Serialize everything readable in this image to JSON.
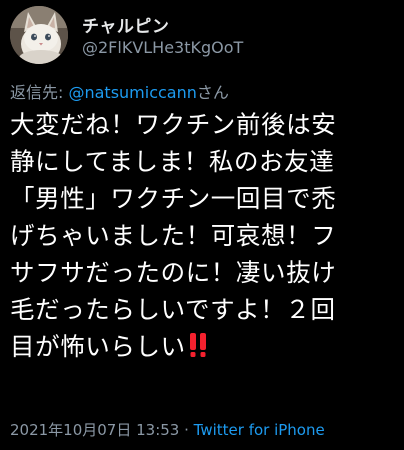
{
  "author": {
    "display_name": "チャルピン",
    "handle": "@2FlKVLHe3tKgOoT"
  },
  "reply": {
    "prefix": "返信先: ",
    "mention": "@natsumiccann",
    "suffix": "さん"
  },
  "body_lines": [
    "大変だね！ワクチン前後は安",
    "静にしてましま！私のお友達",
    "「男性」ワクチン一回目で禿",
    "げちゃいました！可哀想！フ",
    "サフサだったのに！凄い抜け",
    "毛だったらしいですよ！２回",
    "目が怖いらしい"
  ],
  "emoji": {
    "name": "double-exclamation-icon",
    "color": "#f4212e"
  },
  "meta": {
    "timestamp": "2021年10月07日 13:53",
    "separator": " · ",
    "client": "Twitter for iPhone"
  },
  "colors": {
    "background": "#000000",
    "text": "#ffffff",
    "secondary": "#8b98a5",
    "accent": "#1d9bf0"
  }
}
